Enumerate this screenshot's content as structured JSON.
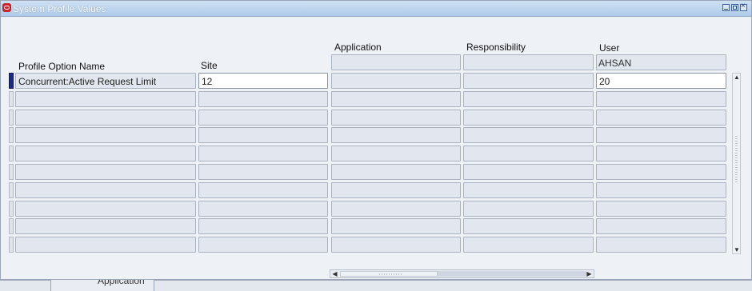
{
  "window": {
    "title": "System Profile Values"
  },
  "columns": {
    "profile_option_name": "Profile Option Name",
    "site": "Site",
    "application": "Application",
    "responsibility": "Responsibility",
    "user": "User"
  },
  "header_values": {
    "application": "",
    "responsibility": "",
    "user": "AHSAN"
  },
  "rows": [
    {
      "profile_option_name": "Concurrent:Active Request Limit",
      "site": "12",
      "application": "",
      "responsibility": "",
      "user": "20"
    },
    {
      "profile_option_name": "",
      "site": "",
      "application": "",
      "responsibility": "",
      "user": ""
    },
    {
      "profile_option_name": "",
      "site": "",
      "application": "",
      "responsibility": "",
      "user": ""
    },
    {
      "profile_option_name": "",
      "site": "",
      "application": "",
      "responsibility": "",
      "user": ""
    },
    {
      "profile_option_name": "",
      "site": "",
      "application": "",
      "responsibility": "",
      "user": ""
    },
    {
      "profile_option_name": "",
      "site": "",
      "application": "",
      "responsibility": "",
      "user": ""
    },
    {
      "profile_option_name": "",
      "site": "",
      "application": "",
      "responsibility": "",
      "user": ""
    },
    {
      "profile_option_name": "",
      "site": "",
      "application": "",
      "responsibility": "",
      "user": ""
    },
    {
      "profile_option_name": "",
      "site": "",
      "application": "",
      "responsibility": "",
      "user": ""
    },
    {
      "profile_option_name": "",
      "site": "",
      "application": "",
      "responsibility": "",
      "user": ""
    }
  ],
  "bottom_tab": {
    "label": "Application"
  },
  "icons": {
    "app": "oracle-app-icon",
    "minimize": "minimize-icon",
    "maximize": "maximize-icon",
    "close": "close-icon",
    "scroll_up": "arrow-up-icon",
    "scroll_down": "arrow-down-icon",
    "scroll_left": "arrow-left-icon",
    "scroll_right": "arrow-right-icon"
  },
  "colors": {
    "active_row": "#1b2b8a",
    "titlebar": "#aecbe9",
    "cell_bg": "#e2e6ee"
  }
}
